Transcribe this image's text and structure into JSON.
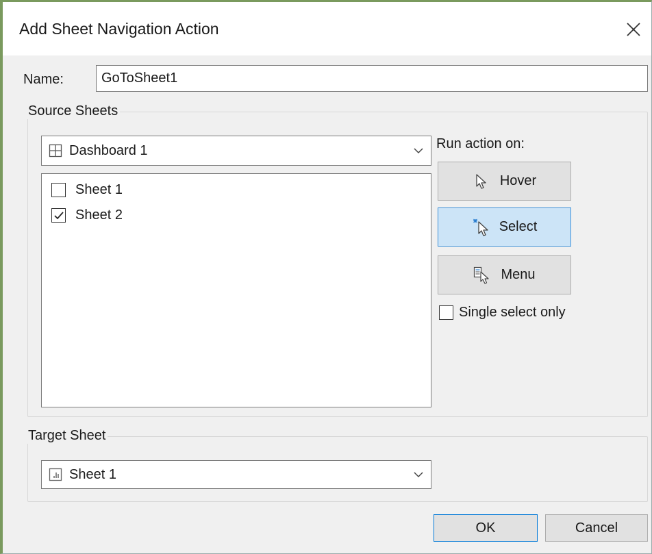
{
  "dialog": {
    "title": "Add Sheet Navigation Action",
    "close_icon": "close-icon"
  },
  "name": {
    "label": "Name:",
    "value": "GoToSheet1"
  },
  "source_sheets": {
    "group_label": "Source Sheets",
    "dropdown": {
      "icon": "dashboard-icon",
      "selected": "Dashboard 1"
    },
    "sheets": [
      {
        "label": "Sheet 1",
        "checked": false
      },
      {
        "label": "Sheet 2",
        "checked": true
      }
    ]
  },
  "run_action": {
    "label": "Run action on:",
    "buttons": [
      {
        "label": "Hover",
        "icon": "hover-pointer-icon",
        "selected": false
      },
      {
        "label": "Select",
        "icon": "select-pointer-icon",
        "selected": true
      },
      {
        "label": "Menu",
        "icon": "menu-pointer-icon",
        "selected": false
      }
    ],
    "single_select": {
      "label": "Single select only",
      "checked": false
    }
  },
  "target_sheet": {
    "group_label": "Target Sheet",
    "dropdown": {
      "icon": "worksheet-icon",
      "selected": "Sheet 1"
    }
  },
  "footer": {
    "ok_label": "OK",
    "cancel_label": "Cancel"
  },
  "colors": {
    "accent": "#0078d7",
    "selected_button_bg": "#cce4f7",
    "frame": "#7a9a5e"
  }
}
